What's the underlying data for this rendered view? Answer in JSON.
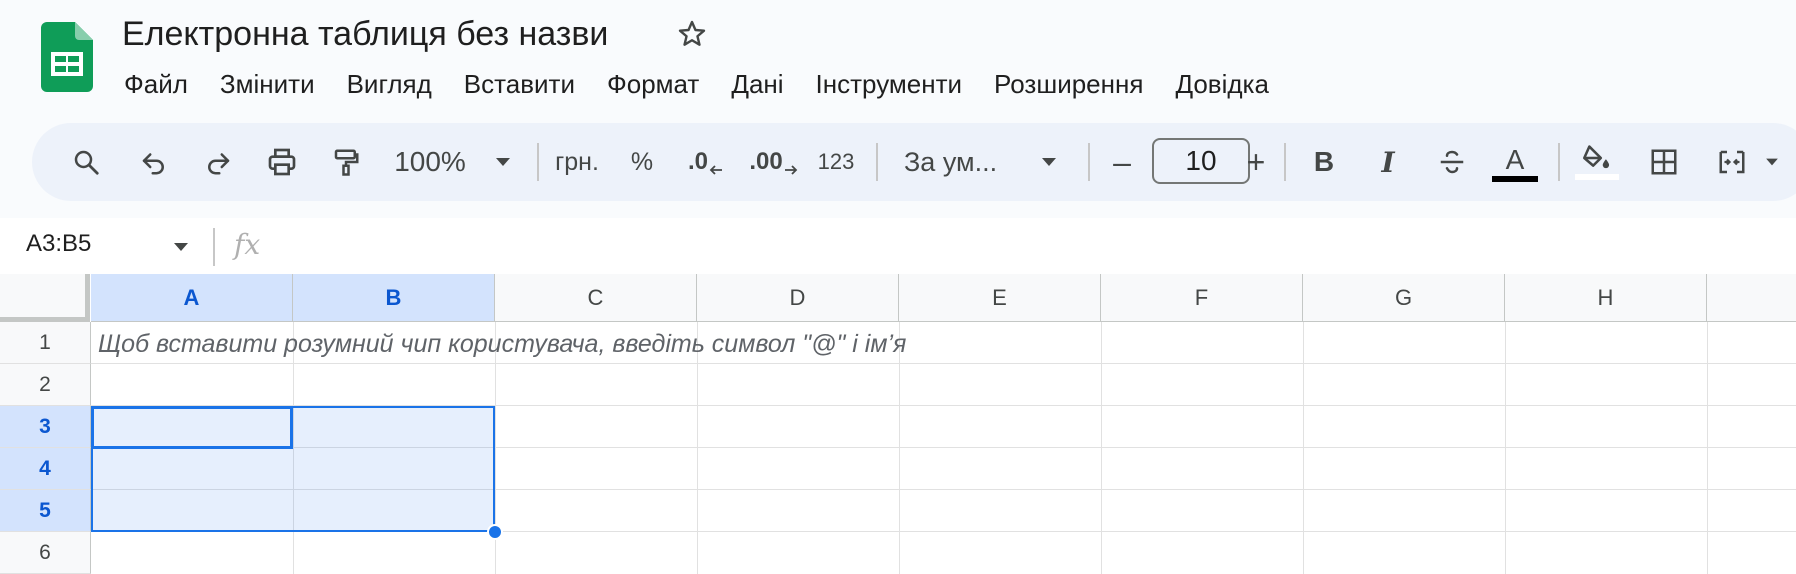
{
  "app": {
    "title": "Електронна таблиця без назви",
    "menu": [
      "Файл",
      "Змінити",
      "Вигляд",
      "Вставити",
      "Формат",
      "Дані",
      "Інструменти",
      "Розширення",
      "Довідка"
    ]
  },
  "toolbar": {
    "zoom": "100%",
    "currency": "грн.",
    "percent": "%",
    "dec_decrease": ".0",
    "dec_increase": ".00",
    "number_format": "123",
    "font_name": "За ум...",
    "font_size_minus": "–",
    "font_size": "10",
    "font_size_plus": "+",
    "bold": "B",
    "italic": "I",
    "text_color_glyph": "A",
    "icons": [
      "search-icon",
      "undo-icon",
      "redo-icon",
      "print-icon",
      "paint-format-icon",
      "zoom-dropdown-icon",
      "strikethrough-icon",
      "text-color-icon",
      "fill-color-icon",
      "borders-icon",
      "merge-cells-icon"
    ]
  },
  "formula_bar": {
    "name_box": "A3:B5",
    "fx": "fx",
    "value": ""
  },
  "sheet": {
    "columns": [
      "A",
      "B",
      "C",
      "D",
      "E",
      "F",
      "G",
      "H"
    ],
    "rows": [
      "1",
      "2",
      "3",
      "4",
      "5",
      "6"
    ],
    "selected_columns": [
      "A",
      "B"
    ],
    "selected_rows": [
      "3",
      "4",
      "5"
    ],
    "selection": "A3:B5",
    "active_cell": "A3",
    "hint_row1": "Щоб вставити розумний чип користувача, введіть символ \"@\" і ім’я"
  },
  "colors": {
    "accent": "#1a73e8",
    "header_selected": "#d3e3fd",
    "toolbar_bg": "#edf2fa",
    "sheets_green": "#0f9d58"
  }
}
